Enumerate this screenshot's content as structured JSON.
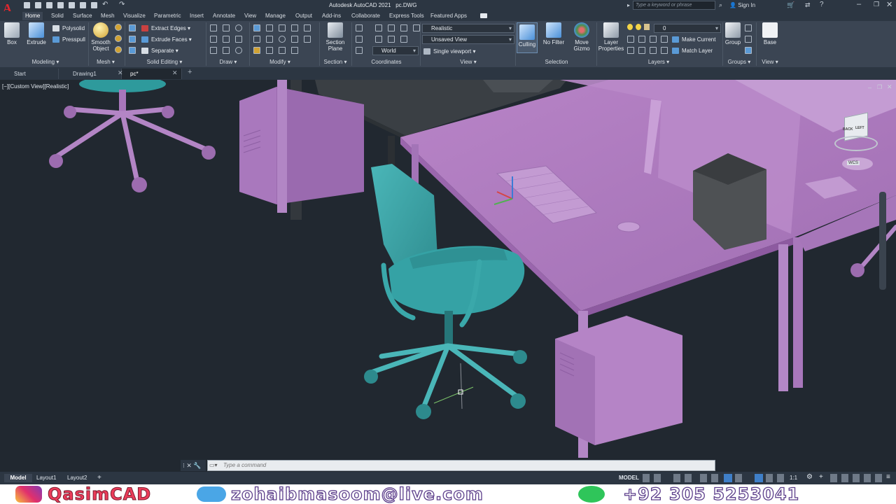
{
  "app": {
    "title": "Autodesk AutoCAD 2021",
    "file": "pc.DWG",
    "logo_letter": "A",
    "search_placeholder": "Type a keyword or phrase",
    "sign_in": "Sign In"
  },
  "menu_tabs": [
    "Home",
    "Solid",
    "Surface",
    "Mesh",
    "Visualize",
    "Parametric",
    "Insert",
    "Annotate",
    "View",
    "Manage",
    "Output",
    "Add-ins",
    "Collaborate",
    "Express Tools",
    "Featured Apps"
  ],
  "active_tab": "Home",
  "ribbon": {
    "modeling": {
      "title": "Modeling",
      "box": "Box",
      "extrude": "Extrude",
      "polysolid": "Polysolid",
      "presspull": "Presspull"
    },
    "mesh": {
      "title": "Mesh",
      "smooth_object": "Smooth Object"
    },
    "solid_editing": {
      "title": "Solid Editing",
      "extract_edges": "Extract Edges",
      "extrude_faces": "Extrude Faces",
      "separate": "Separate"
    },
    "draw": {
      "title": "Draw"
    },
    "modify": {
      "title": "Modify"
    },
    "section": {
      "title": "Section",
      "section_plane": "Section Plane"
    },
    "coordinates": {
      "title": "Coordinates",
      "ucs": "World"
    },
    "view": {
      "title": "View",
      "visual_style": "Realistic",
      "named_view": "Unsaved View",
      "viewport": "Single viewport"
    },
    "selection": {
      "title": "Selection",
      "culling": "Culling",
      "no_filter": "No Filter",
      "move_gizmo": "Move Gizmo"
    },
    "layers": {
      "title": "Layers",
      "layer_properties": "Layer Properties",
      "current_layer": "0",
      "make_current": "Make Current",
      "match_layer": "Match Layer"
    },
    "groups": {
      "title": "Groups",
      "group": "Group"
    },
    "view2": {
      "title": "View",
      "base": "Base"
    }
  },
  "file_tabs": [
    {
      "label": "Start"
    },
    {
      "label": "Drawing1"
    },
    {
      "label": "pc*"
    }
  ],
  "viewport": {
    "label": "[−][Custom View][Realistic]",
    "viewcube_back": "BACK",
    "viewcube_left": "LEFT",
    "wcs": "WCS"
  },
  "command": {
    "placeholder": "Type a command"
  },
  "layout_tabs": [
    "Model",
    "Layout1",
    "Layout2"
  ],
  "status": {
    "mode": "MODEL",
    "scale": "1:1"
  },
  "footer": {
    "brand": "QasimCAD",
    "email": "zohaibmasoom@live.com",
    "phone": "+92 305 5253041"
  },
  "colors": {
    "accent": "#4a90d9",
    "desk": "#b07fc0",
    "chair": "#3aa8aa",
    "brand": "#5b3d8a"
  }
}
